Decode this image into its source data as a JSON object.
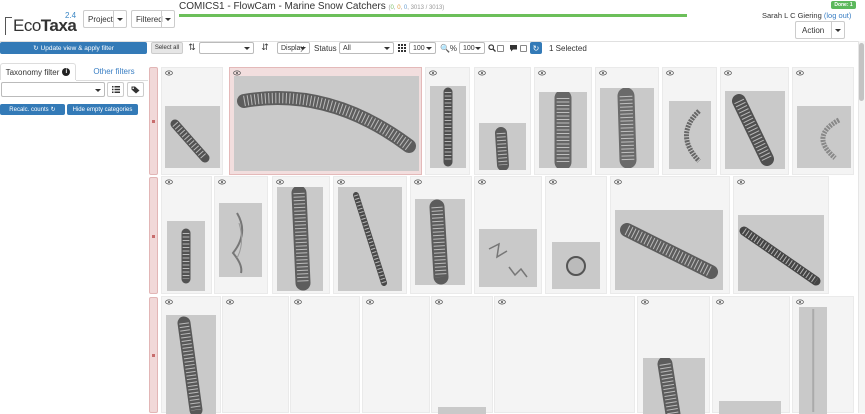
{
  "app": {
    "logo_eco": "Eco",
    "logo_taxa": "Taxa",
    "version": "2.4"
  },
  "header": {
    "project_label": "Project",
    "filtered_label": "Filtered",
    "title": "COMICS1 - FlowCam - Marine Snow Catchers",
    "counts": {
      "validated": "0",
      "dubious": "0",
      "predicted": "0",
      "filtered": "3013",
      "total": "3013"
    },
    "progress_fraction": 1.0,
    "done_badge": "Done: 1",
    "user_name": "Sarah L C Giering",
    "logout_label": "(log out)",
    "action_label": "Action"
  },
  "toolbar": {
    "update_label": "Update view & apply filter",
    "selectall_label": "Select all",
    "sort_value": "",
    "display_value": "Display",
    "status_label": "Status",
    "status_value": "All",
    "per_page_value": "100",
    "zoom_value": "100",
    "selected_text": "1 Selected"
  },
  "sidebar": {
    "tab_taxonomy": "Taxonomy filter",
    "tab_other": "Other filters",
    "recalc_label": "Recalc. counts",
    "hide_label": "Hide empty categories"
  },
  "colors": {
    "primary": "#337ab7",
    "selected_vignette": "#f2dede",
    "done_green": "#5cb85c"
  },
  "icons": [
    "sort-icon",
    "sort-direction-icon",
    "grid-icon",
    "percent-zoom-icon",
    "magnify-icon",
    "comment-icon",
    "refresh-icon",
    "info-icon",
    "list-icon",
    "tag-icon",
    "eye-icon"
  ],
  "vignettes": {
    "row1": 9,
    "row2": 9,
    "row3": 9,
    "selected_index": 1
  }
}
